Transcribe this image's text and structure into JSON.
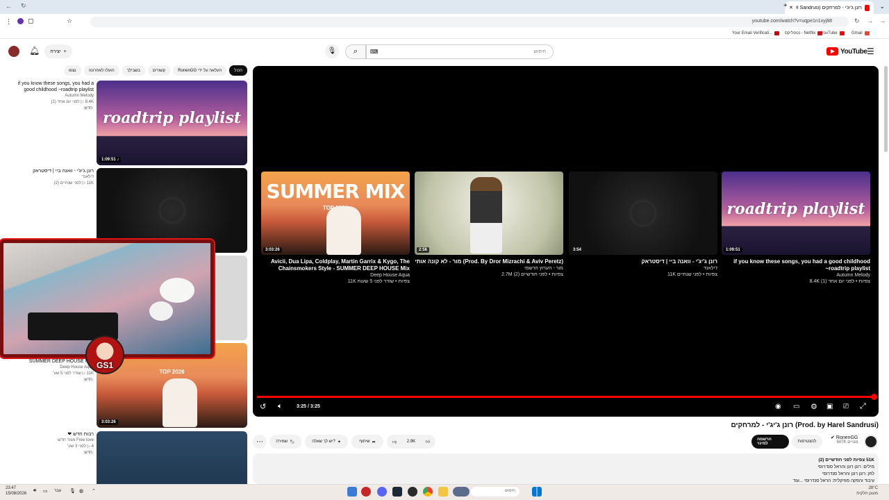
{
  "browser": {
    "tab_title": "רונן ג'יג'י - למרחקים (Prod. by Harel Sandrusi)",
    "url": "youtube.com/watch?v=uqpe1n1xyj88",
    "bookmarks": [
      "Your Email Verificati...",
      "נטפליקס - Netflix",
      "YouTube",
      "Gmail"
    ]
  },
  "youtube": {
    "logo": "YouTube",
    "search_placeholder": "חיפוש",
    "create_label": "יצירה",
    "chips": [
      "הכול",
      "RonenGG העלאה על ידי",
      "קשורים",
      "בשבילך",
      "הועלו לאחרונה",
      "נצפו"
    ]
  },
  "recommendations": [
    {
      "title": "if you know these songs, you had a good childhood ~roadtrip playlist",
      "channel": "Autumn Melody",
      "views": "8.4K ▷ לפני יום אחד (1)",
      "badge": "חדש",
      "duration": "1:09:51 ♪"
    },
    {
      "title": "רונן ג'יג'י - וואנה ביי | דיסטראק",
      "channel": "ז'ילאנד",
      "views": "11K ▷ לפני שנתיים (2)",
      "badge": "",
      "duration": ""
    },
    {
      "title": "",
      "channel": "",
      "views": "",
      "badge": "",
      "duration": ""
    },
    {
      "title": "SUMMER DEEP HOUSE MIX",
      "channel": "Deep House Aqua",
      "views": "11K ▷ שודר לפני 5 שע׳",
      "badge": "חדש",
      "duration": "3:03:26"
    },
    {
      "title": "❤ רבות חדש",
      "channel": "Free love מגזר חדש",
      "views": "4 ▷ לפני 3 שע׳",
      "badge": "חדש",
      "duration": ""
    }
  ],
  "player": {
    "time": "3:25 / 3:25",
    "progress_fraction": 1.0,
    "endscreen": [
      {
        "title": "if you know these songs, you had a good childhood ~roadtrip playlist",
        "channel": "Autumn Melody",
        "views": "8.4K צפיות • לפני יום אחד (1)",
        "duration": "1:09:51"
      },
      {
        "title": "רונן ג'יג'י - וואנה ביי | דיסטראק",
        "channel": "ז'ילאנד",
        "views": "11K צפיות • לפני שנתיים",
        "duration": "3:54"
      },
      {
        "title": "מור - לא קונה אותי (Prod. By Dror Mizrachi & Aviv Peretz)",
        "channel": "מור - הערוץ הרשמי",
        "views": "2.7M צפיות • לפני חודשיים (2)",
        "duration": "2:56"
      },
      {
        "title": "Avicii, Dua Lipa, Coldplay, Martin Garrix & Kygo, The Chainsmokers Style - SUMMER DEEP HOUSE Mix",
        "channel": "Deep House Aqua",
        "views": "11K צפיות • שודר לפני 5 שעות",
        "duration": "3:03:26"
      }
    ]
  },
  "video": {
    "title": "רונן ג'יג'י - למרחקים (Prod. by Harel Sandrusi)",
    "channel": "RonenGG",
    "subscribers": "507K מנויים",
    "subscribed_label": "הרשמה למינוי",
    "notify_label": "להצטרפות",
    "likes": "2.9K",
    "share_label": "שיתוף",
    "ask_label": "יש לך שאלה?",
    "save_label": "שמירה",
    "description_line1": "51K צפיות  לפני חודשיים (2)",
    "description_line2": "מילים: רונן רונן והראל סנדרוסי",
    "description_line3": "לחן: רונן רונן והראל סנדרוסי",
    "description_line4": "עיבוד והפקה מוזיקלית: הראל סנדרוסי ...עוד"
  },
  "overlay": {
    "badge": "GS1"
  },
  "taskbar": {
    "time": "23:47",
    "date": "15/08/2026",
    "lang": "עבר",
    "search": "חיפוש",
    "weather": "28°C",
    "weather_sub": "מעונן חלקית"
  }
}
